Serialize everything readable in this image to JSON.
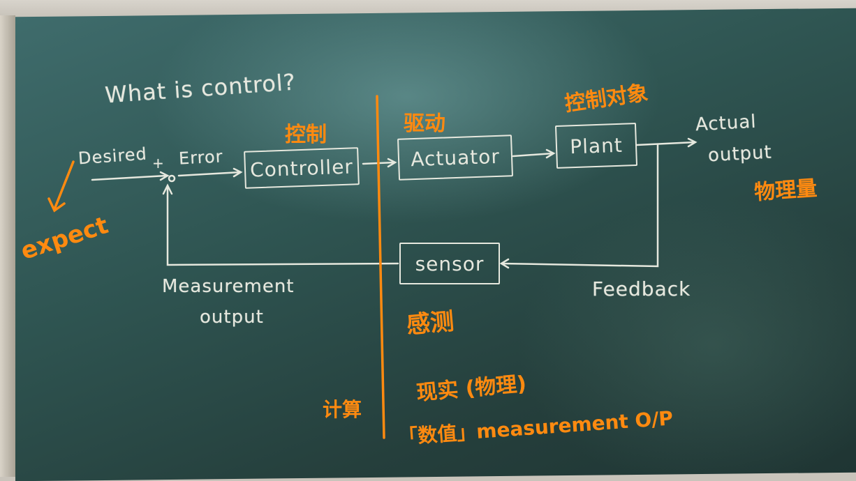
{
  "title": "What is control?",
  "blocks": {
    "controller": "Controller",
    "actuator": "Actuator",
    "plant": "Plant",
    "sensor": "sensor"
  },
  "labels": {
    "desired": "Desired",
    "plus": "+",
    "error": "Error",
    "actual_output_1": "Actual",
    "actual_output_2": "output",
    "feedback": "Feedback",
    "measurement_output_1": "Measurement",
    "measurement_output_2": "output"
  },
  "annotations": {
    "expect": "expect",
    "controller_cn": "控制",
    "actuator_cn": "驱动",
    "plant_cn": "控制对象",
    "physical_quantity": "物理量",
    "sensor_cn": "感测",
    "compute": "计算",
    "reality": "现实 (物理)",
    "numeric": "「数值」measurement O/P"
  },
  "colors": {
    "chalk": "#e6e8de",
    "annotation": "#ff8a10",
    "board": "#2f5552"
  }
}
